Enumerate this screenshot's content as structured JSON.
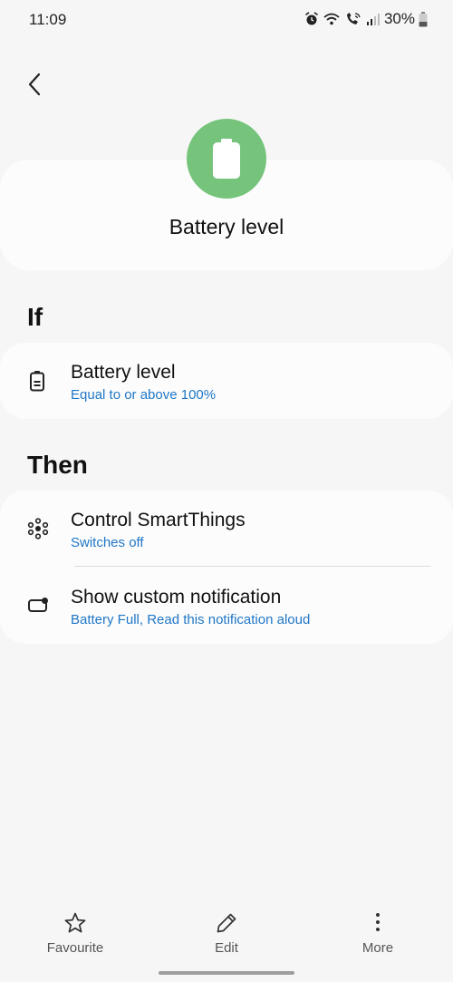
{
  "status_bar": {
    "time": "11:09",
    "battery_percent": "30%"
  },
  "header": {
    "title": "Battery level",
    "icon": "battery-icon",
    "icon_bg": "#76c47c"
  },
  "if_section": {
    "heading": "If",
    "items": [
      {
        "title": "Battery level",
        "subtitle": "Equal to or above 100%",
        "icon": "battery-icon"
      }
    ]
  },
  "then_section": {
    "heading": "Then",
    "items": [
      {
        "title": "Control SmartThings",
        "subtitle": "Switches off",
        "icon": "smartthings-icon"
      },
      {
        "title": "Show custom notification",
        "subtitle": "Battery Full, Read this notification aloud",
        "icon": "notification-icon"
      }
    ]
  },
  "bottom_nav": {
    "favourite": "Favourite",
    "edit": "Edit",
    "more": "More"
  },
  "colors": {
    "accent": "#1f77c7",
    "background": "#f6f6f6",
    "card": "#fcfcfc"
  }
}
